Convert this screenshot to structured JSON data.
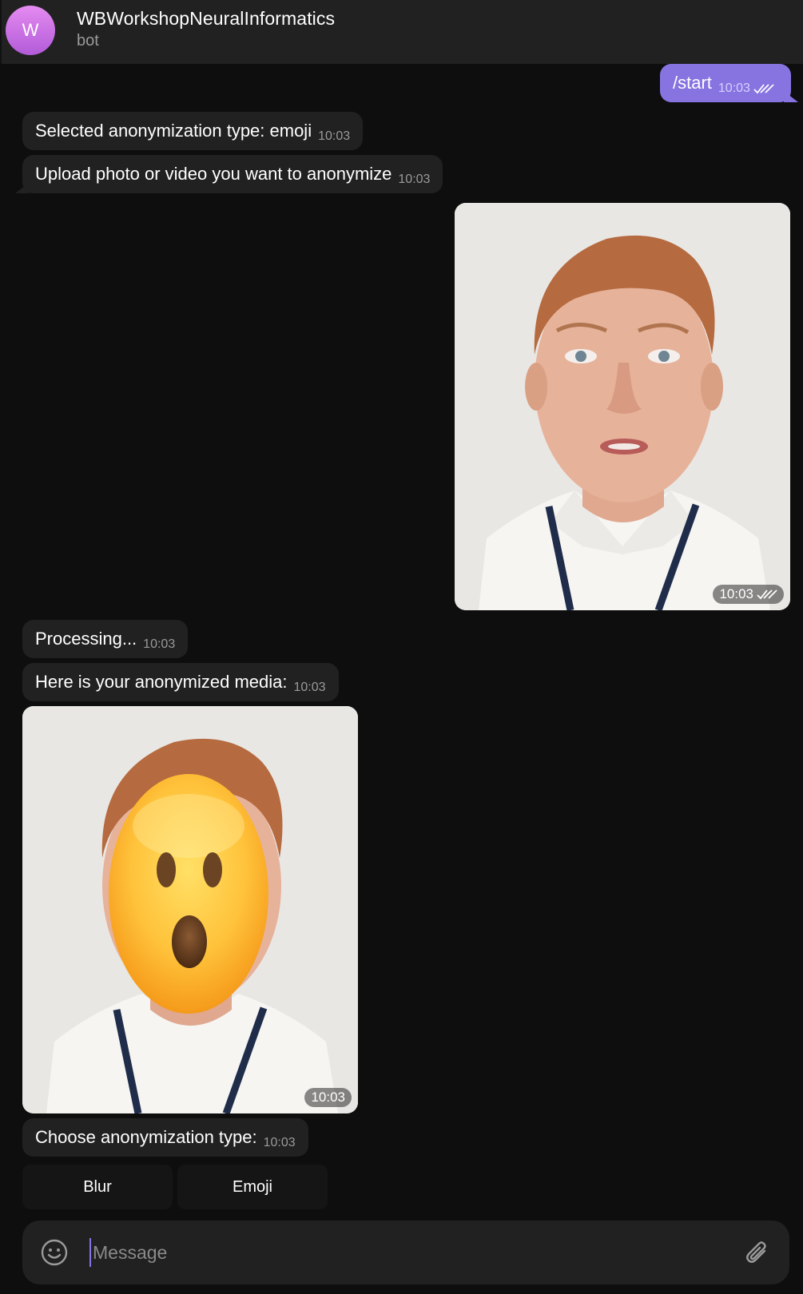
{
  "header": {
    "avatar_letter": "W",
    "title": "WBWorkshopNeuralInformatics",
    "subtitle": "bot"
  },
  "messages": [
    {
      "id": "m1",
      "direction": "out",
      "text": "/start",
      "time": "10:03",
      "read": true
    },
    {
      "id": "m2",
      "direction": "in",
      "text": "Selected anonymization type: emoji",
      "time": "10:03"
    },
    {
      "id": "m3",
      "direction": "in",
      "text": "Upload photo or video you want to anonymize",
      "time": "10:03"
    },
    {
      "id": "m4",
      "direction": "out",
      "type": "photo",
      "time": "10:03",
      "read": true
    },
    {
      "id": "m5",
      "direction": "in",
      "text": "Processing...",
      "time": "10:03"
    },
    {
      "id": "m6",
      "direction": "in",
      "text": "Here is your anonymized media:",
      "time": "10:03"
    },
    {
      "id": "m7",
      "direction": "in",
      "type": "photo",
      "time": "10:03"
    },
    {
      "id": "m8",
      "direction": "in",
      "text": "Choose anonymization type:",
      "time": "10:03"
    }
  ],
  "keyboard": {
    "buttons": [
      "Blur",
      "Emoji"
    ]
  },
  "composer": {
    "placeholder": "Message"
  },
  "icons": {
    "emoji": "smiley-icon",
    "attach": "paperclip-icon",
    "read": "double-check-icon"
  },
  "colors": {
    "accent": "#8774e1",
    "bubble_in": "#212121",
    "background": "#0e0e0f"
  }
}
